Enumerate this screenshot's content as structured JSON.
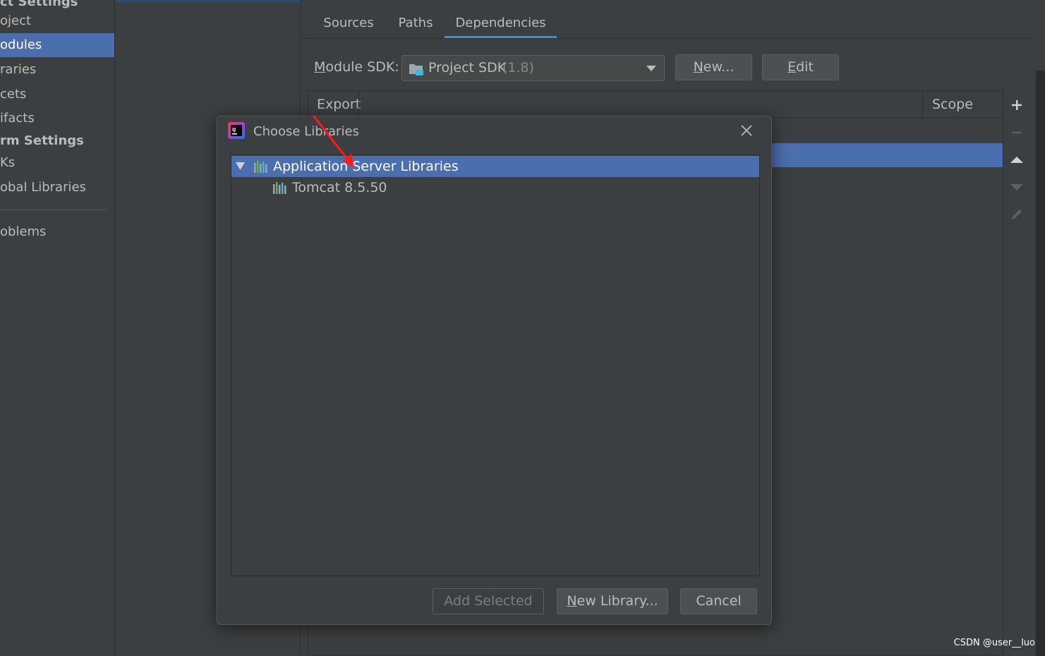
{
  "sidebar": {
    "items": [
      {
        "label": "ct Settings"
      },
      {
        "label": "oject"
      },
      {
        "label": "odules"
      },
      {
        "label": "raries"
      },
      {
        "label": "cets"
      },
      {
        "label": "ifacts"
      },
      {
        "label": "rm Settings"
      },
      {
        "label": "Ks"
      },
      {
        "label": "obal Libraries"
      },
      {
        "label": "oblems"
      }
    ]
  },
  "tabs": [
    {
      "label": "Sources"
    },
    {
      "label": "Paths"
    },
    {
      "label": "Dependencies"
    }
  ],
  "module_sdk": {
    "label_first": "M",
    "label_rest": "odule SDK:",
    "value": "Project SDK",
    "version": "(1.8)",
    "new_first": "N",
    "new_rest": "ew...",
    "edit_first": "E",
    "edit_rest": "dit"
  },
  "dependencies_table": {
    "columns": [
      "Export",
      "Scope"
    ]
  },
  "dialog": {
    "title": "Choose Libraries",
    "tree": [
      {
        "label": "Application Server Libraries"
      },
      {
        "label": "Tomcat 8.5.50"
      }
    ],
    "buttons": {
      "add_selected": "Add Selected",
      "new_library_first": "N",
      "new_library_rest": "ew Library...",
      "cancel": "Cancel"
    }
  },
  "icons": {
    "app_icon": "intellij-icon",
    "folder_icon": "sdk-folder-icon",
    "library_icon": "library-icon",
    "close": "close-icon",
    "add": "plus-icon",
    "remove": "minus-icon",
    "up": "arrow-up-icon",
    "down": "arrow-down-icon",
    "edit": "pencil-icon"
  },
  "colors": {
    "selection": "#4b6eaf",
    "annotation_arrow": "#ff1a1a",
    "tab_underline": "#4a88c7"
  },
  "watermark": "CSDN @user__luo"
}
